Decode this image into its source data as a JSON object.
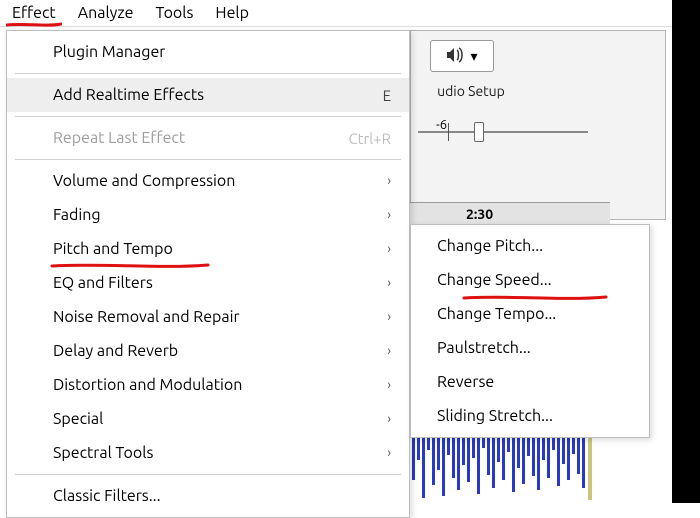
{
  "menubar": {
    "items": [
      "Effect",
      "Analyze",
      "Tools",
      "Help"
    ]
  },
  "effect_menu": {
    "plugin_manager": "Plugin Manager",
    "add_realtime": "Add Realtime Effects",
    "add_realtime_shortcut": "E",
    "repeat_last": "Repeat Last Effect",
    "repeat_last_shortcut": "Ctrl+R",
    "volume_compression": "Volume and Compression",
    "fading": "Fading",
    "pitch_tempo": "Pitch and Tempo",
    "eq_filters": "EQ and Filters",
    "noise_removal": "Noise Removal and Repair",
    "delay_reverb": "Delay and Reverb",
    "distortion_modulation": "Distortion and Modulation",
    "special": "Special",
    "spectral_tools": "Spectral Tools",
    "classic_filters": "Classic Filters..."
  },
  "pitch_submenu": {
    "change_pitch": "Change Pitch...",
    "change_speed": "Change Speed...",
    "change_tempo": "Change Tempo...",
    "paulstretch": "Paulstretch...",
    "reverse": "Reverse",
    "sliding_stretch": "Sliding Stretch..."
  },
  "background": {
    "audio_setup": "udio Setup",
    "slider_tick_label": "-6",
    "timeline_marker": "2:30"
  },
  "icons": {
    "chevron_right": "›",
    "dropdown_caret": "▾",
    "speaker": "🔊"
  }
}
